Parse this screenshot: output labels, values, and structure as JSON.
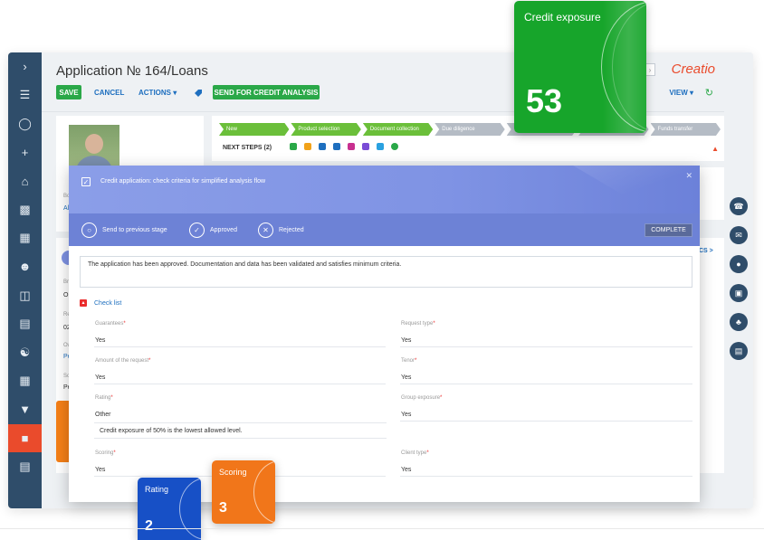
{
  "header": {
    "title": "Application № 164/Loans",
    "save_label": "SAVE",
    "cancel_label": "CANCEL",
    "actions_label": "ACTIONS ▾",
    "send_label": "SEND FOR CREDIT ANALYSIS",
    "logo": "Creatio",
    "view_label": "VIEW ▾"
  },
  "profile": {
    "label_trunc": "Borr",
    "value_trunc": "Alex"
  },
  "left_fields": [
    {
      "label": "Bra",
      "value": "Our"
    },
    {
      "label": "Regi",
      "value": "02/2"
    },
    {
      "label": "Own",
      "value": "Pete"
    },
    {
      "label": "Sou",
      "value": "Pers"
    }
  ],
  "stages": [
    "New",
    "Product selection",
    "Document collection",
    "Due diligence",
    "Li",
    "",
    "Funds transfer"
  ],
  "next_steps_label": "NEXT STEPS (2)",
  "cs_link": "CS >",
  "modal": {
    "title": "Credit application: check criteria for simplified analysis flow",
    "actions": [
      {
        "label": "Send to previous stage"
      },
      {
        "label": "Approved"
      },
      {
        "label": "Rejected"
      }
    ],
    "complete_label": "COMPLETE",
    "comment": "The application has been approved. Documentation and data has been validated and satisfies minimum criteria.",
    "checklist_label": "Check list",
    "fields": {
      "guarantees": {
        "label": "Guarantees",
        "value": "Yes"
      },
      "request_type": {
        "label": "Request type",
        "value": "Yes"
      },
      "amount": {
        "label": "Amount of the request",
        "value": "Yes"
      },
      "tenor": {
        "label": "Tenor",
        "value": "Yes"
      },
      "rating": {
        "label": "Rating",
        "value": "Other"
      },
      "group_exposure": {
        "label": "Group exposure",
        "value": "Yes"
      },
      "scoring": {
        "label": "Scoring",
        "value": "Yes"
      },
      "client_type": {
        "label": "Client type",
        "value": "Yes"
      }
    },
    "note": "Credit exposure of 50% is the lowest allowed level."
  },
  "tiles": {
    "credit": {
      "label": "Credit exposure",
      "value": "53",
      "color": "#17a52b"
    },
    "rating": {
      "label": "Rating",
      "value": "2",
      "color": "#1750c6"
    },
    "scoring": {
      "label": "Scoring",
      "value": "3",
      "color": "#f1761a"
    }
  },
  "colors": {
    "sidebar": "#2f4d6a",
    "accent_green": "#2aa848",
    "accent_red": "#ea4b2c",
    "link": "#1e6fbf"
  }
}
